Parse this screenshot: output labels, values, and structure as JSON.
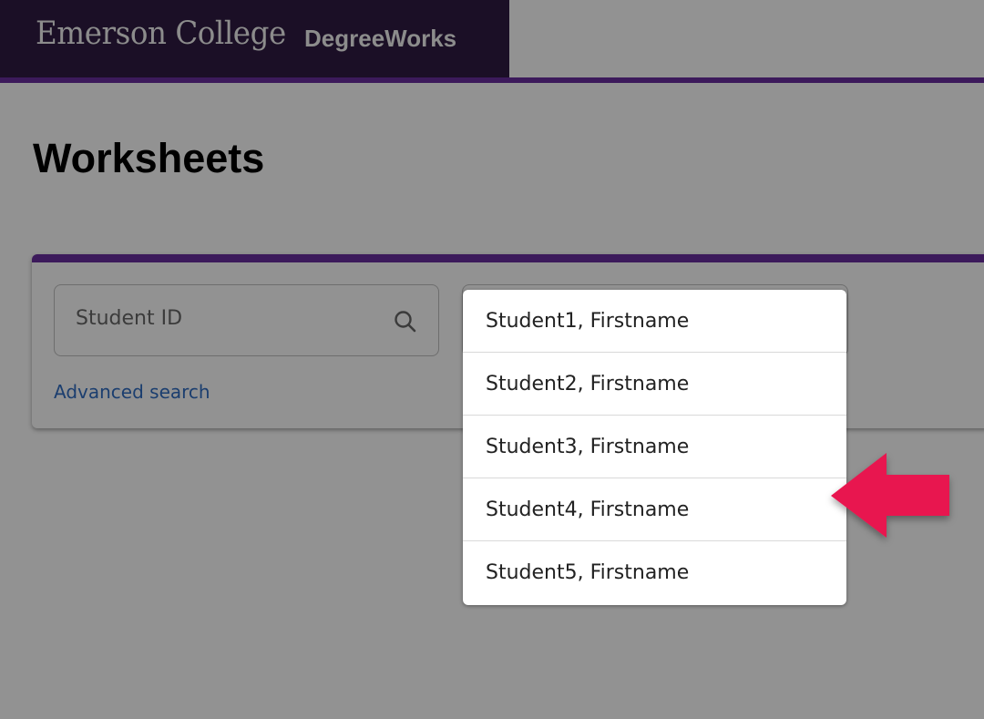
{
  "header": {
    "college_name": "Emerson College",
    "app_name": "DegreeWorks"
  },
  "page": {
    "title": "Worksheets"
  },
  "search": {
    "student_id_placeholder": "Student ID",
    "search_icon": "search-icon",
    "advanced_search_label": "Advanced search"
  },
  "dropdown": {
    "items": [
      {
        "label": "Student1, Firstname"
      },
      {
        "label": "Student2, Firstname"
      },
      {
        "label": "Student3, Firstname"
      },
      {
        "label": "Student4, Firstname"
      },
      {
        "label": "Student5, Firstname"
      }
    ]
  },
  "annotation": {
    "icon": "left-arrow-pointer",
    "color": "#e8194f",
    "points_to_item": "Student4, Firstname"
  },
  "colors": {
    "header_bg": "#1b0f26",
    "accent_purple": "#3c1a5b",
    "link_blue": "#1b3e6f"
  }
}
